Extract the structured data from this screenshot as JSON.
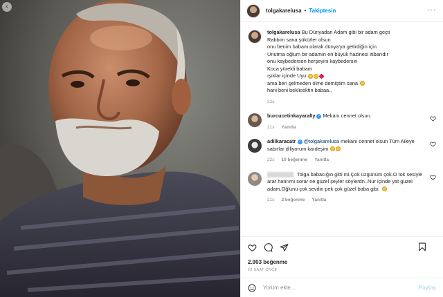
{
  "photo": {
    "nav_icon": "chevron-left-icon"
  },
  "header": {
    "username": "tolgakarelusa",
    "separator": "•",
    "follow_label": "Takiptesin",
    "more_icon": "more-horizontal-icon",
    "more_label": "···"
  },
  "caption": {
    "username": "tolgakarelusa",
    "lines": [
      "Bu Dünyadan Adam gibi bir adam geçti",
      "Rabbim sana şükürler olsun",
      "onu benim babam olarak dünya'ya getirdiğin için",
      "Unutma oğlum bir adamın en büyük hazinesi itibarıdır",
      "onu kaybedersen herşeyini kaybedersin",
      "Koca yürekli babam",
      "ışıklar içinde Uyu",
      "ama ben gelmeden ölme demiştim sana",
      "hani beni beklicektin babaa.."
    ],
    "time": "22s"
  },
  "comments": [
    {
      "username": "burcucetinkayaralIy",
      "verified": true,
      "text": "Mekanı cennet olsun.",
      "time": "21s",
      "likes": "",
      "reply_label": "Yanıtla"
    },
    {
      "username": "adilkaracatr",
      "verified": true,
      "mention": "@tolgakarelusa",
      "text": "mekanı cennet olsun Tüm Aileye sabırlar diliyorum kardeşim",
      "time": "22s",
      "likes": "10 beğenme",
      "reply_label": "Yanıtla"
    },
    {
      "username": "",
      "verified": false,
      "text": "Tolga babacığın gitti mi.Çok üzgünüm çok.O tok sesiyle arar hatırımı sorar ne güzel şeyler söylerdn..Nur içinde yat güzel adam.Oğlunu çok sevdin pek çok güzel baba gibi.",
      "time": "21s",
      "likes": "2 beğenme",
      "reply_label": "Yanıtla"
    }
  ],
  "actions": {
    "likes": "2.903 beğenme",
    "date": "22 SAAT ÖNCE"
  },
  "add_comment": {
    "placeholder": "Yorum ekle...",
    "post_label": "Paylaş"
  },
  "colors": {
    "accent": "#0095f6",
    "text": "#262626",
    "muted": "#8e8e8e",
    "border": "#efefef"
  }
}
